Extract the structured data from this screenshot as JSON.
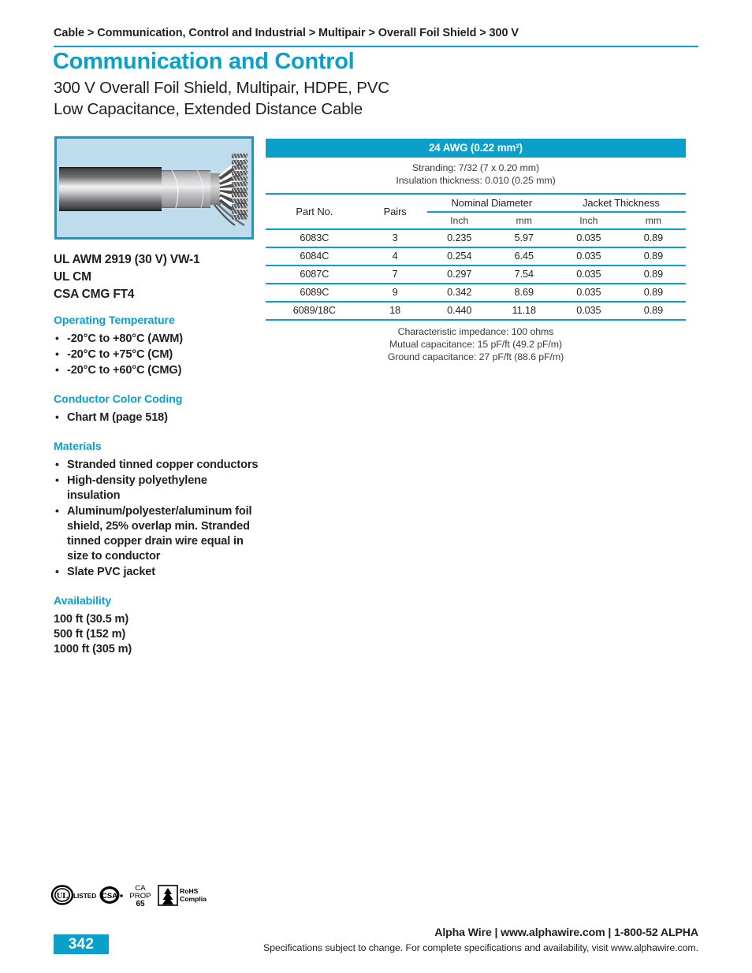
{
  "breadcrumb": "Cable > Communication, Control and Industrial > Multipair > Overall Foil Shield > 300 V",
  "title": {
    "main": "Communication and Control",
    "sub_line1": "300 V Overall Foil Shield, Multipair, HDPE, PVC",
    "sub_line2": "Low Capacitance, Extended Distance Cable"
  },
  "product_image": {
    "alt": "cut-away multipair cable with overall foil shield",
    "border_color": "#0c9fc9",
    "background_color": "#bfdced"
  },
  "approvals": [
    "UL AWM 2919 (30 V) VW-1",
    "UL CM",
    "CSA CMG FT4"
  ],
  "spec_sections": [
    {
      "heading": "Operating Temperature",
      "items": [
        "-20°C to +80°C (AWM)",
        "-20°C to +75°C (CM)",
        "-20°C to +60°C (CMG)"
      ]
    },
    {
      "heading": "Conductor Color Coding",
      "items": [
        "Chart M (page 518)"
      ]
    },
    {
      "heading": "Materials",
      "items": [
        "Stranded tinned copper conductors",
        "High-density polyethylene insulation",
        "Aluminum/polyester/aluminum foil shield, 25% overlap min. Stranded tinned copper drain wire equal in size to conductor",
        "Slate PVC jacket"
      ]
    }
  ],
  "availability": {
    "heading": "Availability",
    "lines": [
      "100 ft (30.5 m)",
      "500 ft (152 m)",
      "1000 ft (305 m)"
    ]
  },
  "table": {
    "awg_header": "24 AWG (0.22 mm²)",
    "awg_header_sup": "2",
    "awg_header_text": "24 AWG (0.22 mm",
    "awg_header_tail": ")",
    "pre_notes": [
      "Stranding: 7/32 (7 x 0.20 mm)",
      "Insulation thickness: 0.010 (0.25 mm)"
    ],
    "headers": {
      "part_no": "Part No.",
      "pairs": "Pairs",
      "nominal_diameter": "Nominal Diameter",
      "jacket_thickness": "Jacket Thickness",
      "unit_inch_1": "Inch",
      "unit_mm_1": "mm",
      "unit_inch_2": "Inch",
      "unit_mm_2": "mm"
    },
    "rows": [
      {
        "part_no": "6083C",
        "pairs": "3",
        "od_inch": "0.235",
        "od_mm": "5.97",
        "jacket_inch": "0.035",
        "jacket_mm": "0.89"
      },
      {
        "part_no": "6084C",
        "pairs": "4",
        "od_inch": "0.254",
        "od_mm": "6.45",
        "jacket_inch": "0.035",
        "jacket_mm": "0.89"
      },
      {
        "part_no": "6087C",
        "pairs": "7",
        "od_inch": "0.297",
        "od_mm": "7.54",
        "jacket_inch": "0.035",
        "jacket_mm": "0.89"
      },
      {
        "part_no": "6089C",
        "pairs": "9",
        "od_inch": "0.342",
        "od_mm": "8.69",
        "jacket_inch": "0.035",
        "jacket_mm": "0.89"
      },
      {
        "part_no": "6089/18C",
        "pairs": "18",
        "od_inch": "0.440",
        "od_mm": "11.18",
        "jacket_inch": "0.035",
        "jacket_mm": "0.89"
      }
    ],
    "post_notes": [
      "Characteristic impedance: 100 ohms",
      "Mutual capacitance: 15 pF/ft (49.2 pF/m)",
      "Ground capacitance: 27 pF/ft (88.6 pF/m)"
    ]
  },
  "certifications": [
    {
      "name": "ul-listed",
      "mark": "UL",
      "label": "LISTED"
    },
    {
      "name": "csa",
      "mark": "CSA",
      "label": ""
    },
    {
      "name": "ca-prop-65",
      "line1": "CA",
      "line2": "PROP",
      "line3": "65"
    },
    {
      "name": "rohs-compliant",
      "line1": "RoHS",
      "line2": "Compliant"
    }
  ],
  "footer": {
    "page_number": "342",
    "company_line": "Alpha Wire | www.alphawire.com | 1-800-52 ALPHA",
    "disclaimer": "Specifications subject to change. For complete specifications and availability, visit www.alphawire.com."
  },
  "colors": {
    "accent": "#0c9fc9",
    "text": "#231f20",
    "note_text": "#3c3c3b"
  }
}
